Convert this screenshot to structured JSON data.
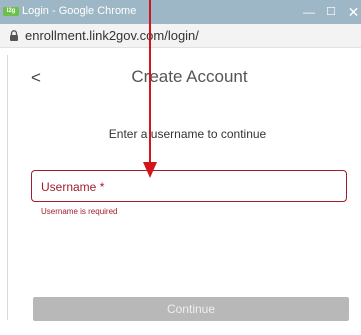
{
  "window": {
    "title": "Login - Google Chrome",
    "logo_text": "l2g",
    "minimize_glyph": "—",
    "maximize_glyph": "☐",
    "close_glyph": "✕"
  },
  "address_bar": {
    "url": "enrollment.link2gov.com/login/",
    "lock_icon": "lock-icon"
  },
  "page": {
    "back_glyph": "<",
    "title": "Create Account",
    "instruction": "Enter a username to continue"
  },
  "form": {
    "username_label": "Username *",
    "username_value": "",
    "error_message": "Username is required",
    "continue_label": "Continue"
  },
  "colors": {
    "titlebar": "#9db7c6",
    "error": "#a11c2d",
    "button_disabled": "#b8b8b8",
    "annotation": "#d2151a"
  }
}
